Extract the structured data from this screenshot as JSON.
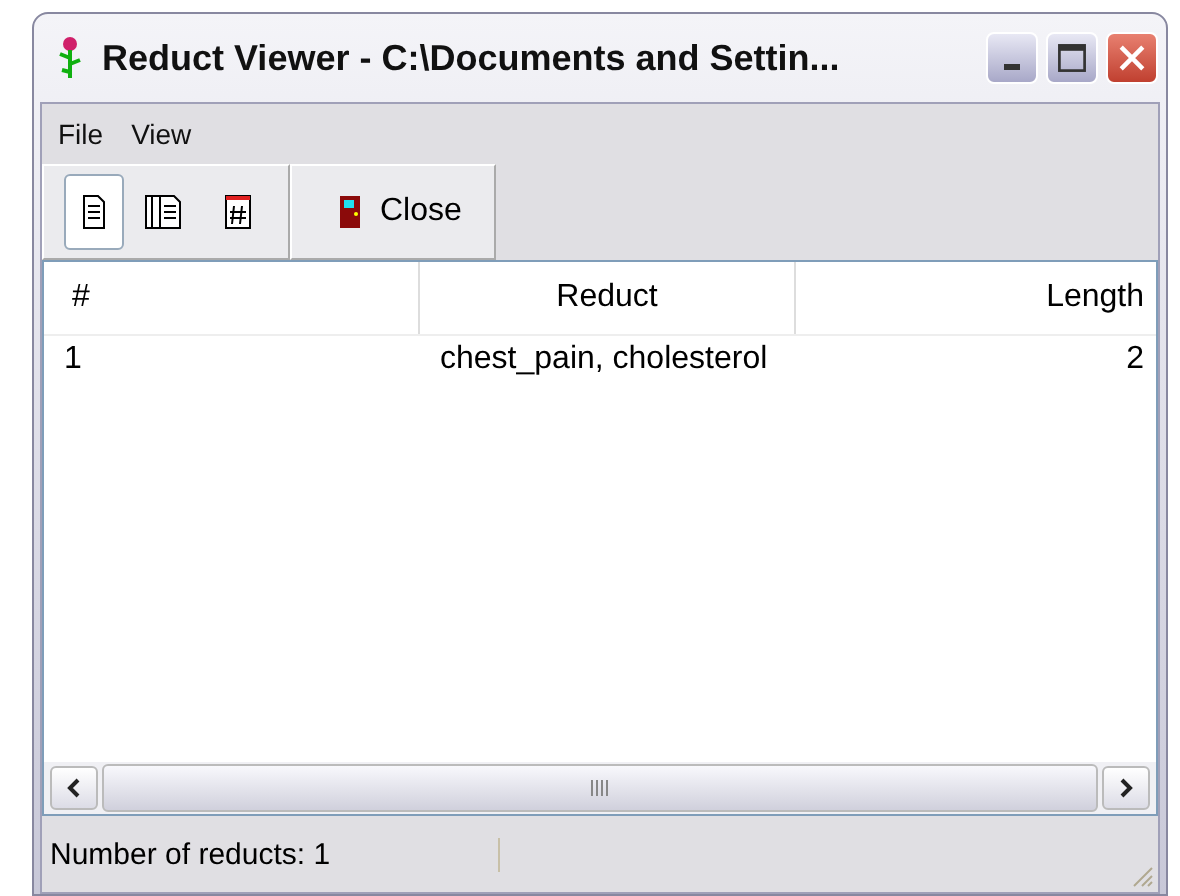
{
  "window": {
    "title": "Reduct Viewer - C:\\Documents and Settin..."
  },
  "menu": [
    "File",
    "View"
  ],
  "toolbar": {
    "buttons": [
      {
        "kind": "single",
        "selected": true
      },
      {
        "kind": "multi",
        "selected": false
      },
      {
        "kind": "number",
        "selected": false
      }
    ],
    "close": "Close"
  },
  "table": {
    "columns": [
      "#",
      "Reduct",
      "Length"
    ],
    "rows": [
      [
        "1",
        "chest_pain, cholesterol",
        "2"
      ]
    ]
  },
  "status_bar": "Number of reducts: 1"
}
